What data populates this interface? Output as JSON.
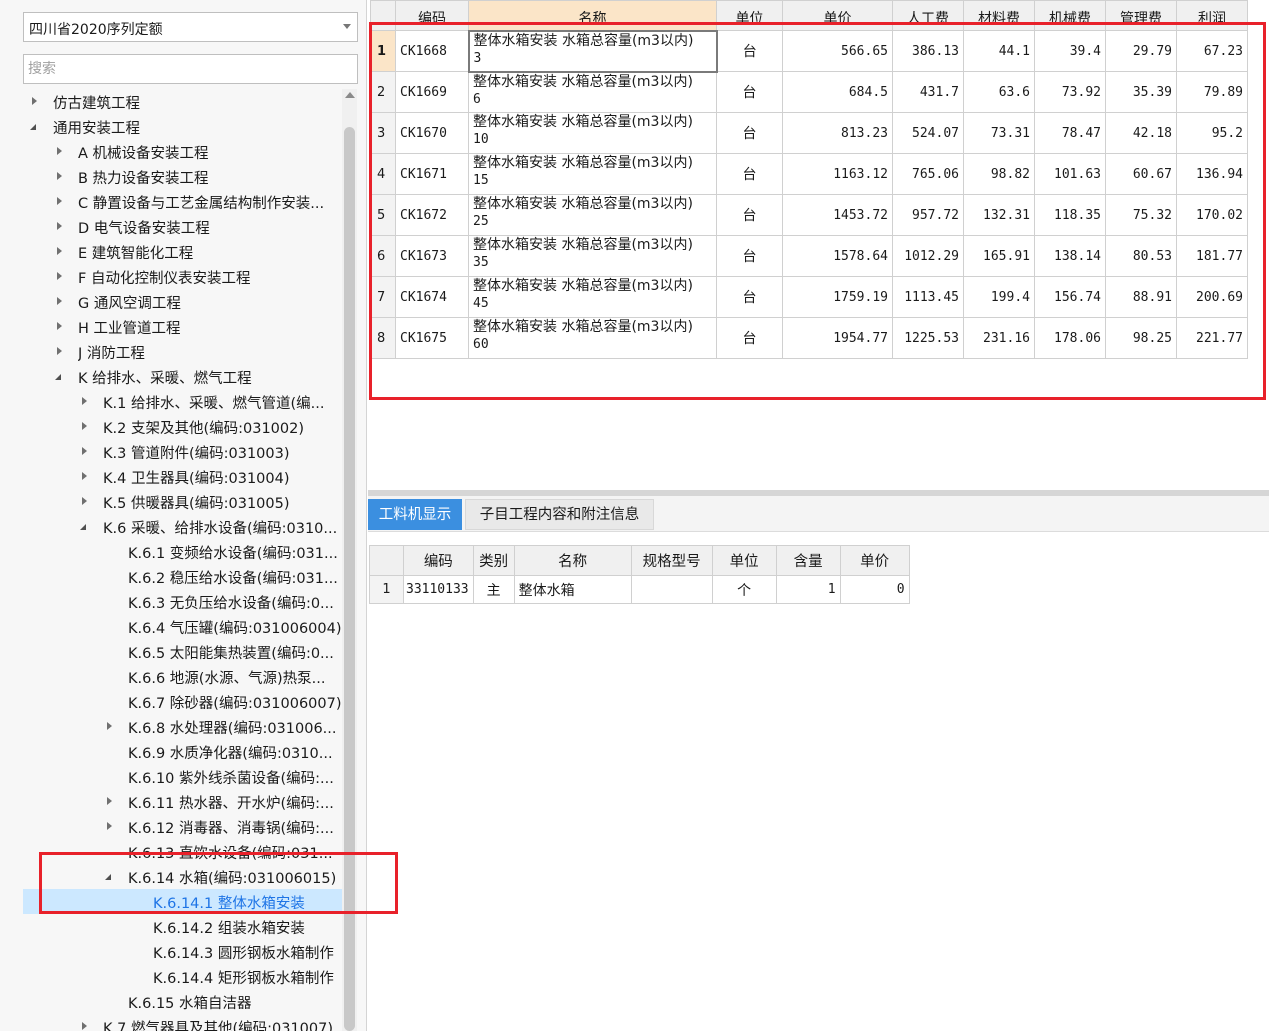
{
  "left_panel": {
    "quota_select_value": "四川省2020序列定额",
    "search_placeholder": "搜索",
    "tree": [
      {
        "label": "仿古建筑工程",
        "level": 0,
        "state": "collapsed",
        "selected": false
      },
      {
        "label": "通用安装工程",
        "level": 0,
        "state": "expanded",
        "selected": false
      },
      {
        "label": "A 机械设备安装工程",
        "level": 1,
        "state": "collapsed",
        "selected": false
      },
      {
        "label": "B 热力设备安装工程",
        "level": 1,
        "state": "collapsed",
        "selected": false
      },
      {
        "label": "C 静置设备与工艺金属结构制作安装...",
        "level": 1,
        "state": "collapsed",
        "selected": false
      },
      {
        "label": "D 电气设备安装工程",
        "level": 1,
        "state": "collapsed",
        "selected": false
      },
      {
        "label": "E 建筑智能化工程",
        "level": 1,
        "state": "collapsed",
        "selected": false
      },
      {
        "label": "F 自动化控制仪表安装工程",
        "level": 1,
        "state": "collapsed",
        "selected": false
      },
      {
        "label": "G 通风空调工程",
        "level": 1,
        "state": "collapsed",
        "selected": false
      },
      {
        "label": "H 工业管道工程",
        "level": 1,
        "state": "collapsed",
        "selected": false
      },
      {
        "label": "J 消防工程",
        "level": 1,
        "state": "collapsed",
        "selected": false
      },
      {
        "label": "K 给排水、采暖、燃气工程",
        "level": 1,
        "state": "expanded",
        "selected": false
      },
      {
        "label": "K.1 给排水、采暖、燃气管道(编...",
        "level": 2,
        "state": "collapsed",
        "selected": false
      },
      {
        "label": "K.2 支架及其他(编码:031002)",
        "level": 2,
        "state": "collapsed",
        "selected": false
      },
      {
        "label": "K.3 管道附件(编码:031003)",
        "level": 2,
        "state": "collapsed",
        "selected": false
      },
      {
        "label": "K.4 卫生器具(编码:031004)",
        "level": 2,
        "state": "collapsed",
        "selected": false
      },
      {
        "label": "K.5 供暖器具(编码:031005)",
        "level": 2,
        "state": "collapsed",
        "selected": false
      },
      {
        "label": "K.6 采暖、给排水设备(编码:0310...",
        "level": 2,
        "state": "expanded",
        "selected": false
      },
      {
        "label": "K.6.1 变频给水设备(编码:031...",
        "level": 3,
        "state": "leaf",
        "selected": false
      },
      {
        "label": "K.6.2 稳压给水设备(编码:031...",
        "level": 3,
        "state": "leaf",
        "selected": false
      },
      {
        "label": "K.6.3 无负压给水设备(编码:0...",
        "level": 3,
        "state": "leaf",
        "selected": false
      },
      {
        "label": "K.6.4 气压罐(编码:031006004)",
        "level": 3,
        "state": "leaf",
        "selected": false
      },
      {
        "label": "K.6.5 太阳能集热装置(编码:0...",
        "level": 3,
        "state": "leaf",
        "selected": false
      },
      {
        "label": "K.6.6 地源(水源、气源)热泵...",
        "level": 3,
        "state": "leaf",
        "selected": false
      },
      {
        "label": "K.6.7 除砂器(编码:031006007)",
        "level": 3,
        "state": "leaf",
        "selected": false
      },
      {
        "label": "K.6.8 水处理器(编码:031006...",
        "level": 3,
        "state": "collapsed",
        "selected": false
      },
      {
        "label": "K.6.9 水质净化器(编码:0310...",
        "level": 3,
        "state": "leaf",
        "selected": false
      },
      {
        "label": "K.6.10 紫外线杀菌设备(编码:...",
        "level": 3,
        "state": "leaf",
        "selected": false
      },
      {
        "label": "K.6.11 热水器、开水炉(编码:...",
        "level": 3,
        "state": "collapsed",
        "selected": false
      },
      {
        "label": "K.6.12 消毒器、消毒锅(编码:...",
        "level": 3,
        "state": "collapsed",
        "selected": false
      },
      {
        "label": "K.6.13 直饮水设备(编码:031...",
        "level": 3,
        "state": "leaf",
        "selected": false
      },
      {
        "label": "K.6.14 水箱(编码:031006015)",
        "level": 3,
        "state": "expanded",
        "selected": false
      },
      {
        "label": "K.6.14.1 整体水箱安装",
        "level": 4,
        "state": "leaf",
        "selected": true
      },
      {
        "label": "K.6.14.2 组装水箱安装",
        "level": 4,
        "state": "leaf",
        "selected": false
      },
      {
        "label": "K.6.14.3 圆形钢板水箱制作",
        "level": 4,
        "state": "leaf",
        "selected": false
      },
      {
        "label": "K.6.14.4 矩形钢板水箱制作",
        "level": 4,
        "state": "leaf",
        "selected": false
      },
      {
        "label": "K.6.15 水箱自洁器",
        "level": 3,
        "state": "leaf",
        "selected": false
      },
      {
        "label": "K.7 燃气器具及其他(编码:031007)",
        "level": 2,
        "state": "collapsed",
        "selected": false
      }
    ]
  },
  "quota_table": {
    "headers": [
      "",
      "编码",
      "名称",
      "单位",
      "单价",
      "人工费",
      "材料费",
      "机械费",
      "管理费",
      "利润"
    ],
    "rows": [
      {
        "idx": "1",
        "code": "CK1668",
        "name": "整体水箱安装 水箱总容量(m3以内)",
        "name_cap": "3",
        "unit": "台",
        "price": "566.65",
        "labor": "386.13",
        "material": "44.1",
        "machine": "39.4",
        "mgmt": "29.79",
        "profit": "67.23"
      },
      {
        "idx": "2",
        "code": "CK1669",
        "name": "整体水箱安装 水箱总容量(m3以内)",
        "name_cap": "6",
        "unit": "台",
        "price": "684.5",
        "labor": "431.7",
        "material": "63.6",
        "machine": "73.92",
        "mgmt": "35.39",
        "profit": "79.89"
      },
      {
        "idx": "3",
        "code": "CK1670",
        "name": "整体水箱安装 水箱总容量(m3以内)",
        "name_cap": "10",
        "unit": "台",
        "price": "813.23",
        "labor": "524.07",
        "material": "73.31",
        "machine": "78.47",
        "mgmt": "42.18",
        "profit": "95.2"
      },
      {
        "idx": "4",
        "code": "CK1671",
        "name": "整体水箱安装 水箱总容量(m3以内)",
        "name_cap": "15",
        "unit": "台",
        "price": "1163.12",
        "labor": "765.06",
        "material": "98.82",
        "machine": "101.63",
        "mgmt": "60.67",
        "profit": "136.94"
      },
      {
        "idx": "5",
        "code": "CK1672",
        "name": "整体水箱安装 水箱总容量(m3以内)",
        "name_cap": "25",
        "unit": "台",
        "price": "1453.72",
        "labor": "957.72",
        "material": "132.31",
        "machine": "118.35",
        "mgmt": "75.32",
        "profit": "170.02"
      },
      {
        "idx": "6",
        "code": "CK1673",
        "name": "整体水箱安装 水箱总容量(m3以内)",
        "name_cap": "35",
        "unit": "台",
        "price": "1578.64",
        "labor": "1012.29",
        "material": "165.91",
        "machine": "138.14",
        "mgmt": "80.53",
        "profit": "181.77"
      },
      {
        "idx": "7",
        "code": "CK1674",
        "name": "整体水箱安装 水箱总容量(m3以内)",
        "name_cap": "45",
        "unit": "台",
        "price": "1759.19",
        "labor": "1113.45",
        "material": "199.4",
        "machine": "156.74",
        "mgmt": "88.91",
        "profit": "200.69"
      },
      {
        "idx": "8",
        "code": "CK1675",
        "name": "整体水箱安装 水箱总容量(m3以内)",
        "name_cap": "60",
        "unit": "台",
        "price": "1954.77",
        "labor": "1225.53",
        "material": "231.16",
        "machine": "178.06",
        "mgmt": "98.25",
        "profit": "221.77"
      }
    ]
  },
  "bottom_panel": {
    "tabs": [
      "工料机显示",
      "子目工程内容和附注信息"
    ],
    "active_tab": 0,
    "resource_table": {
      "headers": [
        "",
        "编码",
        "类别",
        "名称",
        "规格型号",
        "单位",
        "含量",
        "单价"
      ],
      "rows": [
        {
          "idx": "1",
          "code": "33110133",
          "category": "主",
          "name": "整体水箱",
          "spec": "",
          "unit": "个",
          "qty": "1",
          "price": "0"
        }
      ]
    }
  },
  "colors": {
    "annotation_red": "#e8212a",
    "selection_blue": "#cce8ff",
    "selected_text_blue": "#1e74e6",
    "active_tab_blue": "#3b8fe0",
    "highlight_orange": "#fbe5c8"
  }
}
